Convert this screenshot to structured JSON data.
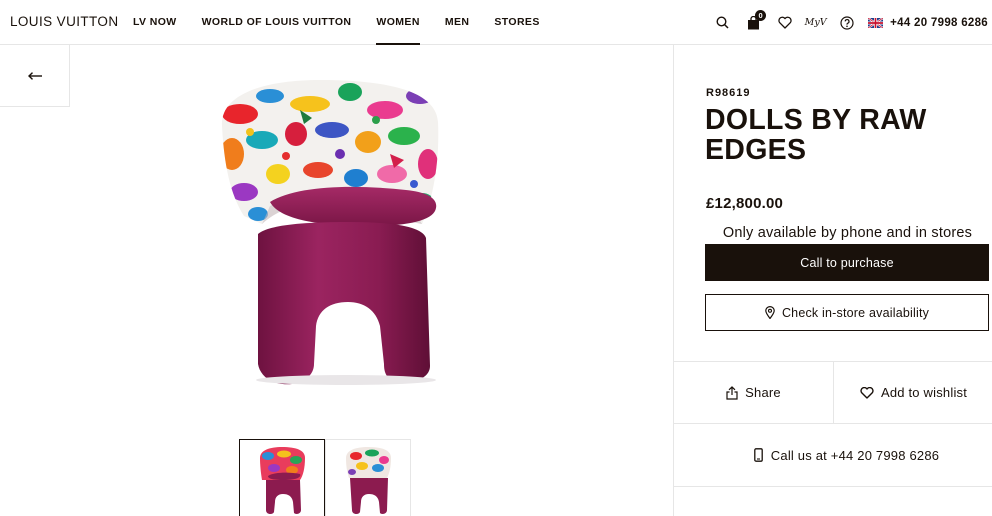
{
  "header": {
    "logo": "LOUIS VUITTON",
    "nav": [
      {
        "label": "LV NOW",
        "active": false
      },
      {
        "label": "WORLD OF LOUIS VUITTON",
        "active": false
      },
      {
        "label": "WOMEN",
        "active": true
      },
      {
        "label": "MEN",
        "active": false
      },
      {
        "label": "STORES",
        "active": false
      }
    ],
    "cart_count": "0",
    "myv_label": "MyV",
    "phone": "+44 20 7998 6286",
    "icons": [
      "search-icon",
      "shopping-bag-icon",
      "heart-icon",
      "my-lv-icon",
      "help-icon",
      "uk-flag-icon"
    ]
  },
  "product": {
    "sku": "R98619",
    "title": "DOLLS BY RAW EDGES",
    "price": "£12,800.00",
    "availability": "Only available by phone and in stores",
    "call_button": "Call to purchase",
    "store_button": "Check in-store availability",
    "share": "Share",
    "wishlist": "Add to wishlist",
    "call_us": "Call us at +44 20 7998 6286",
    "colors": {
      "magenta": "#8c1b4f",
      "dark": "#19110b"
    }
  }
}
